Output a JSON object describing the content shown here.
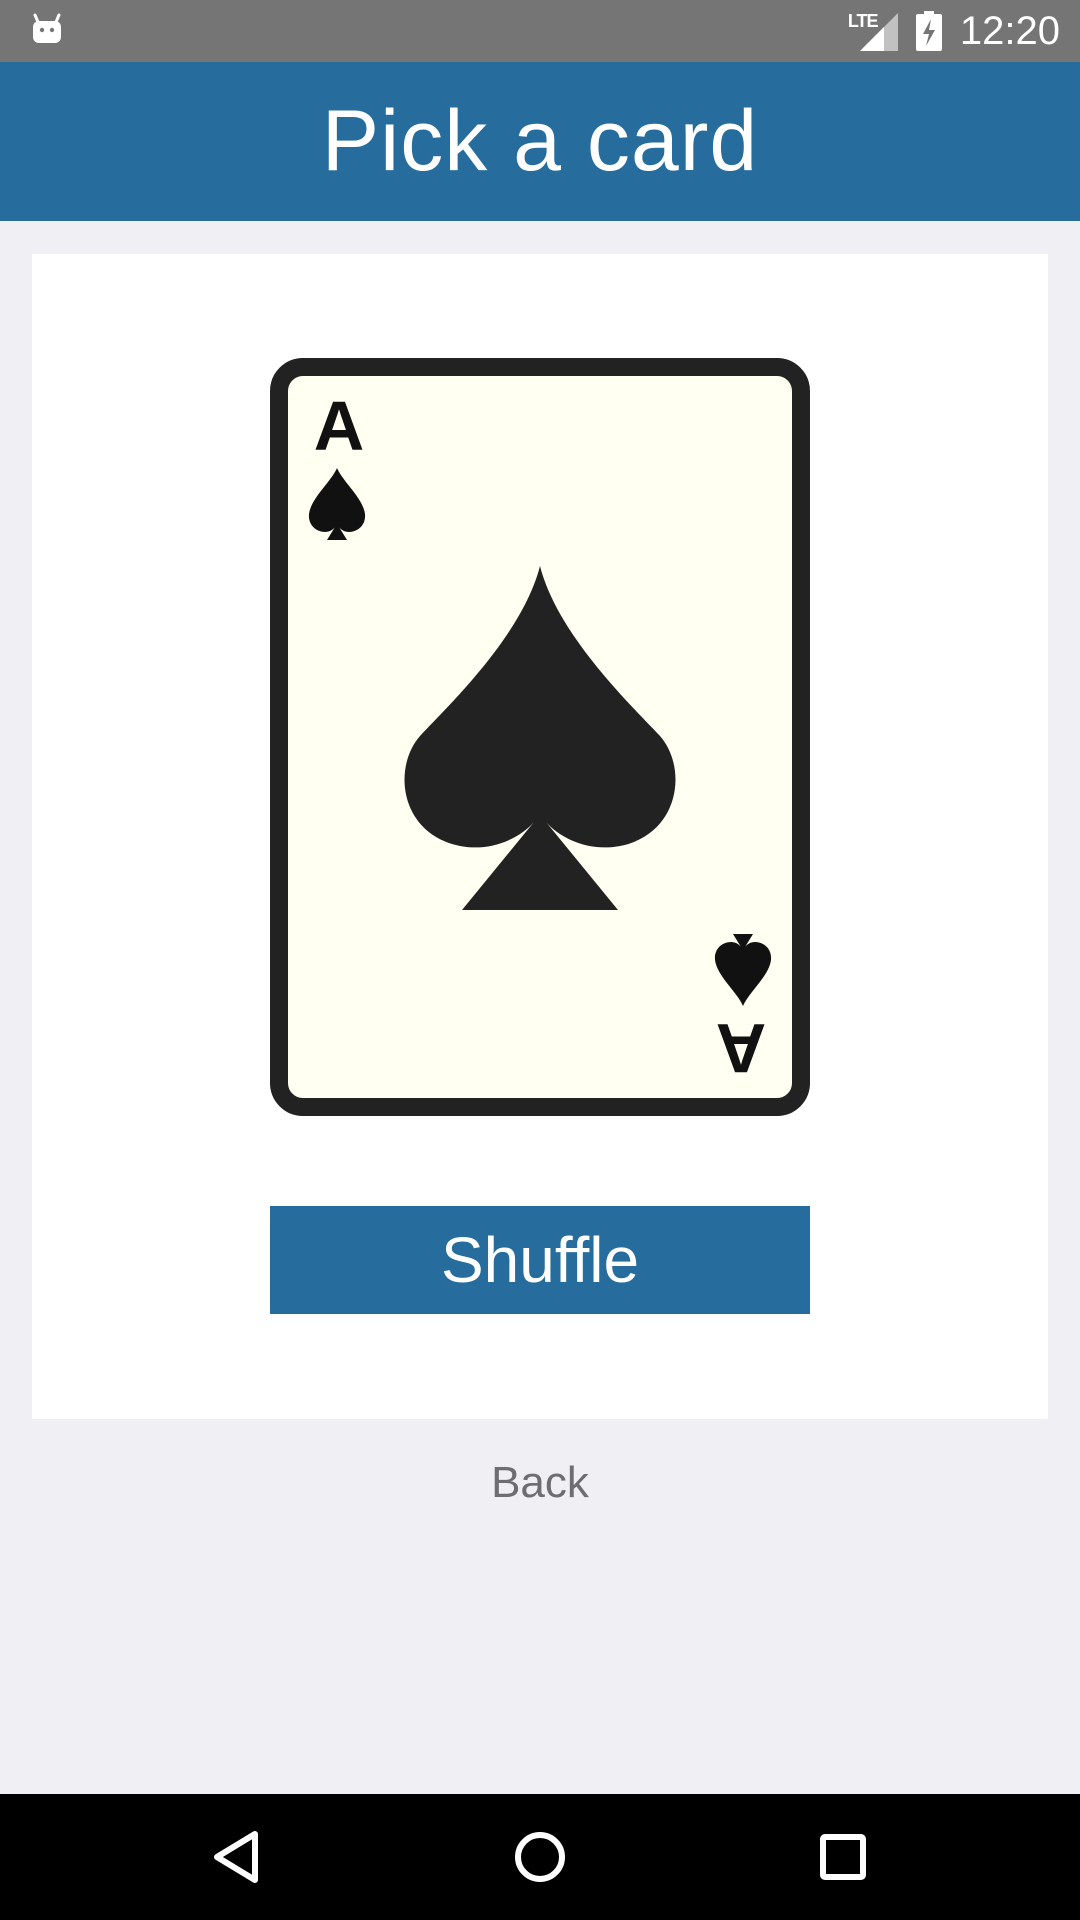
{
  "status_bar": {
    "app_icon": "android-icon",
    "network": "LTE",
    "signal_icon": "signal-icon",
    "battery_icon": "battery-charging-icon",
    "time": "12:20"
  },
  "app_bar": {
    "title": "Pick a card"
  },
  "card": {
    "rank": "A",
    "suit": "spades",
    "suit_icon": "spade-icon",
    "face_color": "#fffff2",
    "border_color": "#222222"
  },
  "actions": {
    "shuffle_label": "Shuffle",
    "back_label": "Back"
  },
  "nav_bar": {
    "back_icon": "nav-back-icon",
    "home_icon": "nav-home-icon",
    "recents_icon": "nav-recents-icon"
  },
  "colors": {
    "primary": "#266d9e",
    "background": "#efeff4",
    "status_bar": "#757575",
    "link_text": "#6d6d72"
  }
}
